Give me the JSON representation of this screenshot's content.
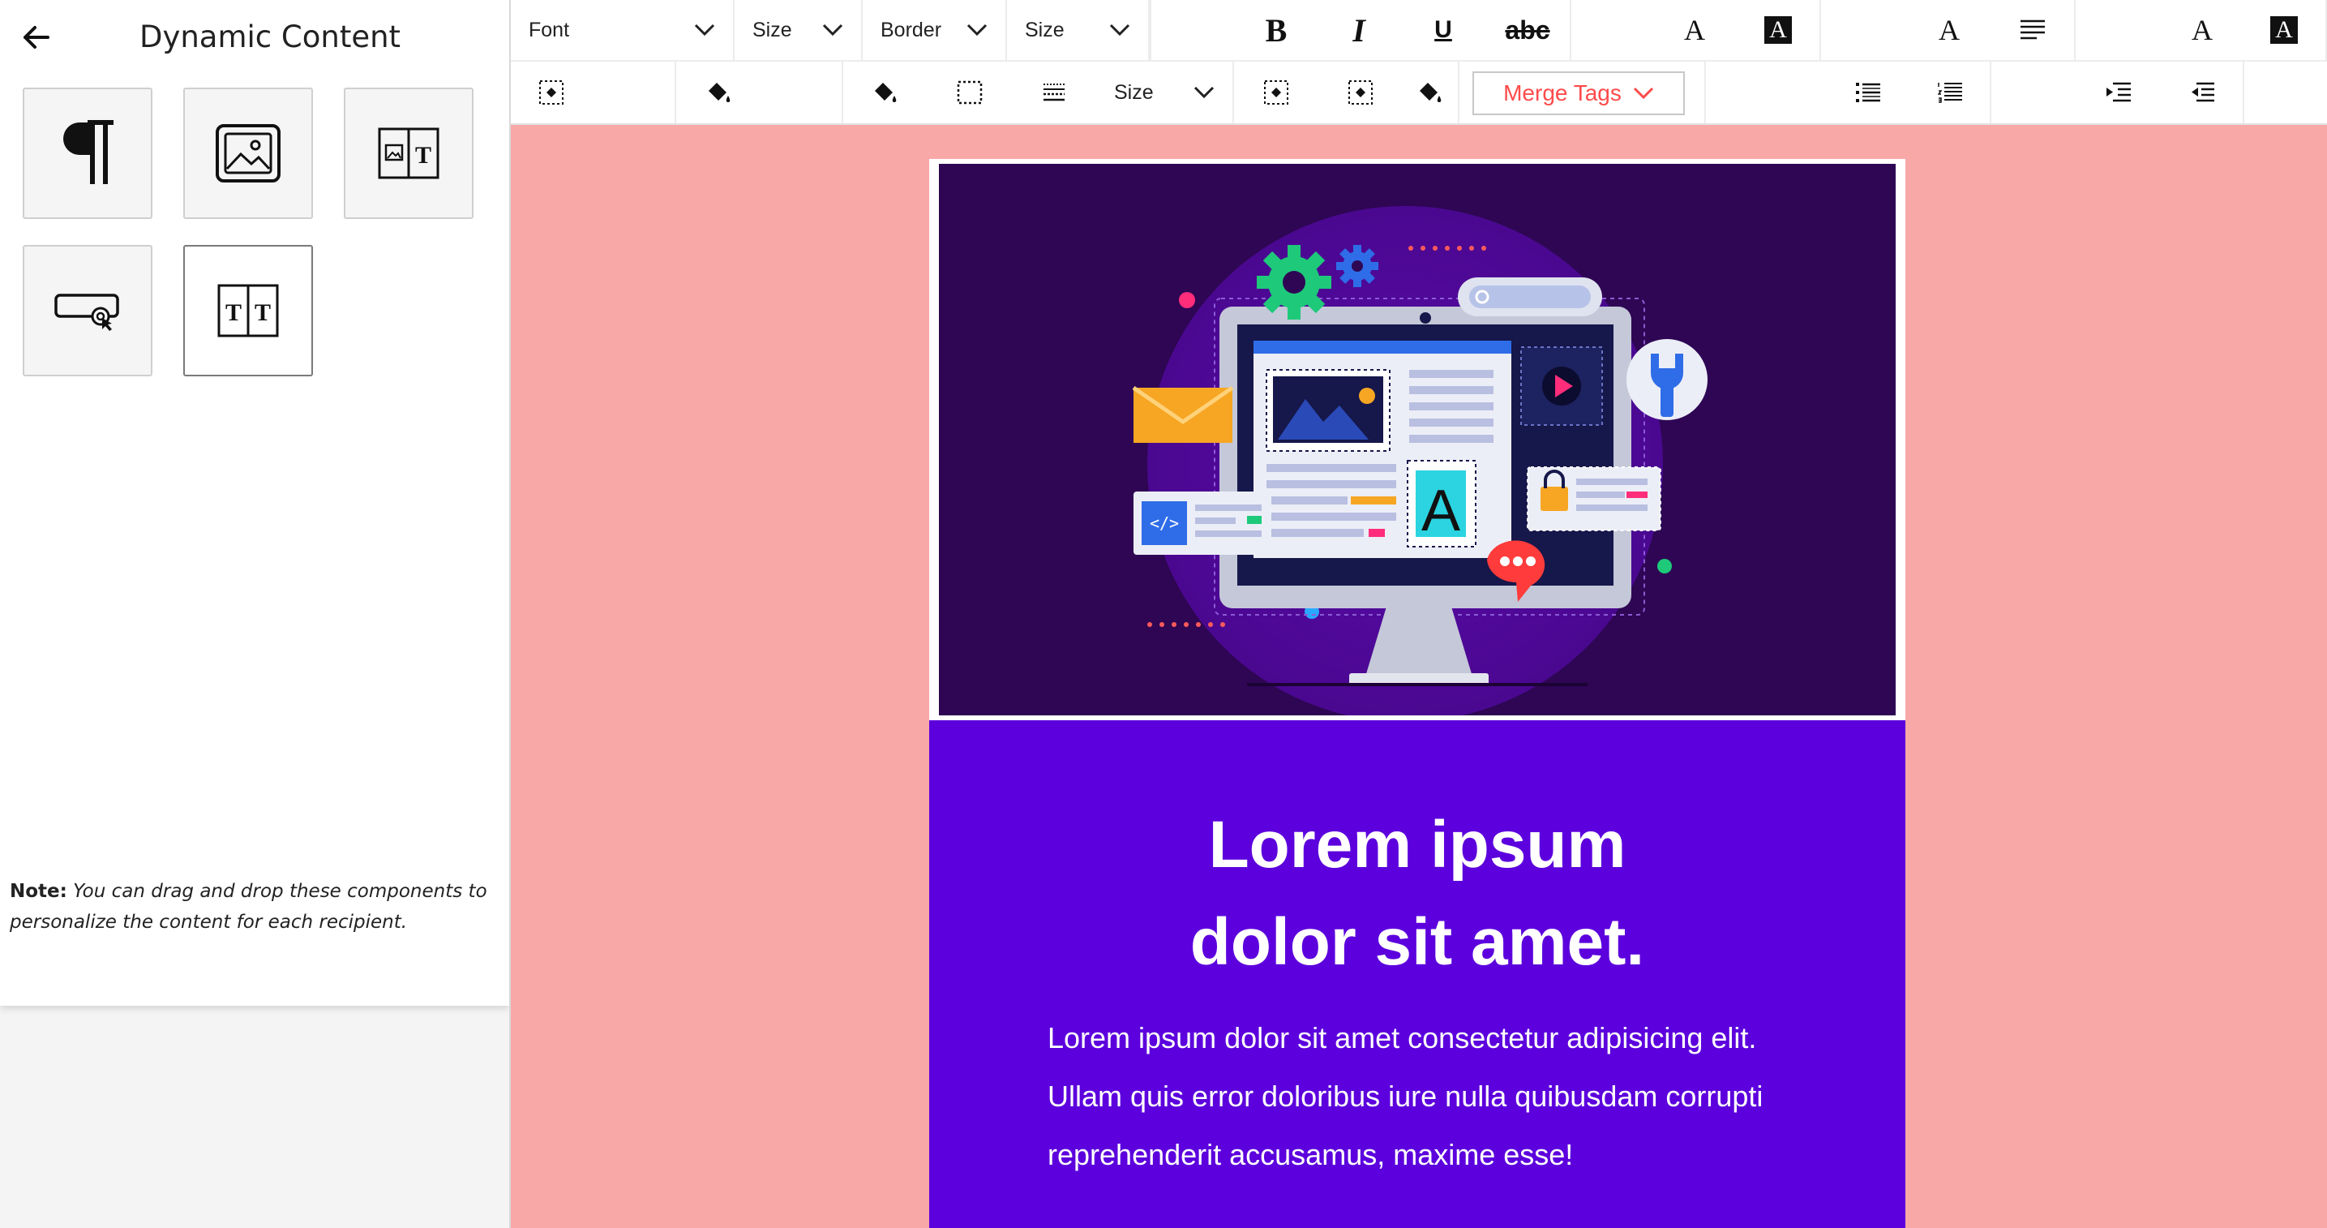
{
  "sidebar": {
    "title": "Dynamic Content",
    "tiles": [
      {
        "name": "paragraph-block",
        "icon": "paragraph-icon"
      },
      {
        "name": "image-block",
        "icon": "image-icon"
      },
      {
        "name": "image-text-block",
        "icon": "image-text-icon"
      },
      {
        "name": "button-block",
        "icon": "button-click-icon"
      },
      {
        "name": "two-column-text-block",
        "icon": "two-column-text-icon"
      }
    ],
    "note_label": "Note:",
    "note_text": " You can drag and drop these components to personalize the content for each recipient."
  },
  "toolbar": {
    "row1": {
      "font_label": "Font",
      "size_label": "Size",
      "border_label": "Border",
      "size2_label": "Size",
      "bold": "B",
      "italic": "I",
      "underline": "U",
      "strike": "abc",
      "font_color": "A",
      "bg_color": "A",
      "font_color2": "A",
      "font_color3": "A",
      "bg_color3": "A"
    },
    "row2": {
      "size_label": "Size",
      "merge_tags_label": "Merge Tags"
    }
  },
  "email": {
    "headline_line1": "Lorem ipsum",
    "headline_line2": "dolor sit amet.",
    "body": "Lorem ipsum dolor sit amet consectetur adipisicing elit. Ullam quis error doloribus iure nulla quibusdam corrupti reprehenderit accusamus, maxime esse!",
    "hero_letter": "A"
  },
  "colors": {
    "canvas_bg": "#f9a8a8",
    "email_purple": "#5c00dd",
    "hero_bg": "#2e0654",
    "merge_accent": "#ff4b4b"
  }
}
